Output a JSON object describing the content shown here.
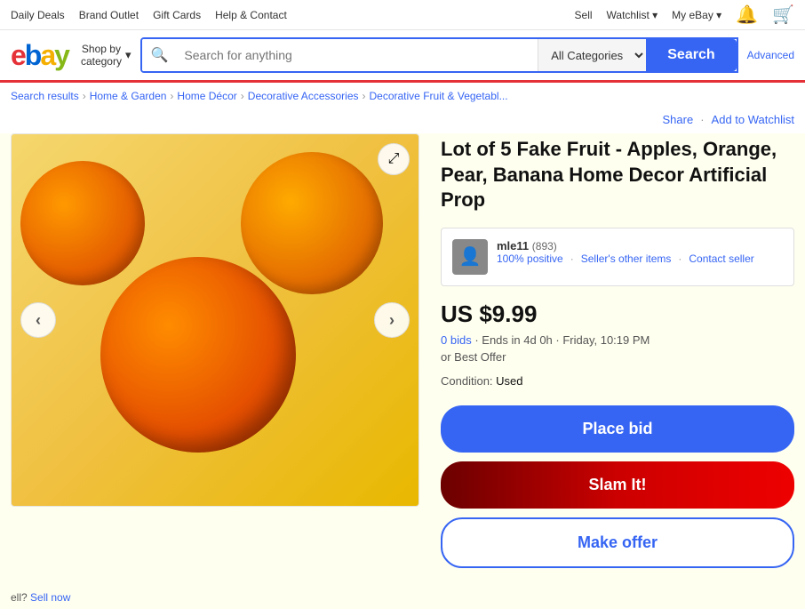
{
  "topNav": {
    "links": [
      "Daily Deals",
      "Brand Outlet",
      "Gift Cards",
      "Help & Contact"
    ],
    "rightLinks": [
      "Sell",
      "Watchlist",
      "My eBay"
    ],
    "watchlistLabel": "Watchlist",
    "myEbayLabel": "My eBay",
    "sellLabel": "Sell"
  },
  "header": {
    "logoText": "ebay",
    "shopByLabel": "Shop by\ncategory",
    "searchPlaceholder": "Search for anything",
    "categoryDefault": "All Categories",
    "searchButtonLabel": "Search",
    "advancedLabel": "Advanced"
  },
  "breadcrumb": {
    "items": [
      {
        "label": "Search results",
        "href": "#"
      },
      {
        "label": "Home & Garden",
        "href": "#"
      },
      {
        "label": "Home Décor",
        "href": "#"
      },
      {
        "label": "Decorative Accessories",
        "href": "#"
      },
      {
        "label": "Decorative Fruit & Vegetabl...",
        "href": "#"
      }
    ]
  },
  "actionRow": {
    "shareLabel": "Share",
    "addToWatchlistLabel": "Add to Watchlist"
  },
  "product": {
    "title": "Lot of 5 Fake Fruit - Apples, Orange, Pear, Banana Home Decor Artificial Prop",
    "seller": {
      "name": "mle11",
      "rating": "(893)",
      "positive": "100% positive",
      "otherItems": "Seller's other items",
      "contactSeller": "Contact seller"
    },
    "price": "US $9.99",
    "bids": "0 bids",
    "endsIn": "Ends in 4d 0h · Friday, 10:19 PM",
    "bestOffer": "or Best Offer",
    "conditionLabel": "Condition:",
    "conditionValue": "Used",
    "placeBidLabel": "Place bid",
    "slamItLabel": "Slam It!",
    "makeOfferLabel": "Make offer"
  },
  "footer": {
    "sellText": "ell?",
    "sellNowLabel": "Sell now"
  }
}
